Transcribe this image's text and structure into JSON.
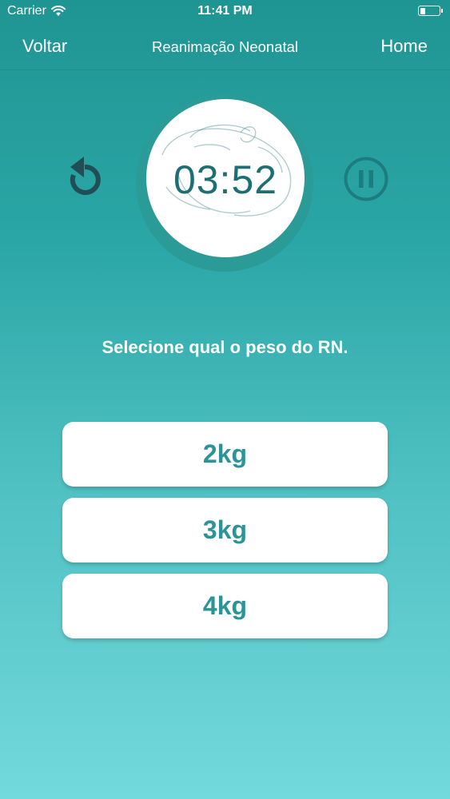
{
  "status_bar": {
    "carrier": "Carrier",
    "time": "11:41 PM"
  },
  "nav": {
    "back_label": "Voltar",
    "title": "Reanimação Neonatal",
    "home_label": "Home"
  },
  "timer": {
    "value": "03:52"
  },
  "prompt": "Selecione qual o peso do RN.",
  "weight_options": [
    {
      "label": "2kg"
    },
    {
      "label": "3kg"
    },
    {
      "label": "4kg"
    }
  ],
  "colors": {
    "accent": "#2b9497",
    "timer_text": "#1d6f73",
    "icon_dark": "#1f4f55"
  }
}
